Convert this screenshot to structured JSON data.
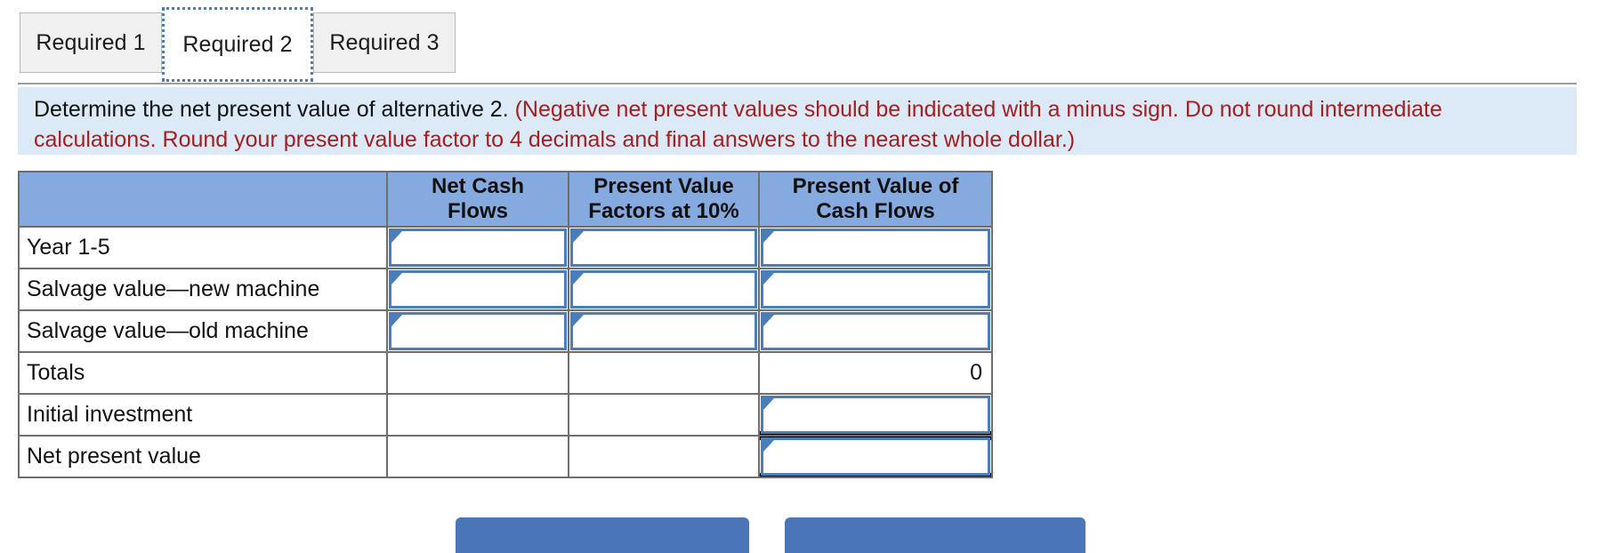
{
  "tabs": [
    {
      "label": "Required 1",
      "selected": false
    },
    {
      "label": "Required 2",
      "selected": true
    },
    {
      "label": "Required 3",
      "selected": false
    }
  ],
  "instruction": {
    "prompt": "Determine the net present value of alternative 2.",
    "note": "(Negative net present values should be indicated with a minus sign. Do not round intermediate calculations. Round your present value factor to 4 decimals and final answers to the nearest whole dollar.)"
  },
  "table": {
    "headers": [
      "",
      "Net Cash Flows",
      "Present Value Factors at 10%",
      "Present Value of Cash Flows"
    ],
    "header_lines": [
      [
        "",
        ""
      ],
      [
        "Net Cash",
        "Flows"
      ],
      [
        "Present Value",
        "Factors at 10%"
      ],
      [
        "Present Value of",
        "Cash Flows"
      ]
    ],
    "rows": [
      {
        "label": "Year 1-5",
        "net_cash_flows": {
          "value": "",
          "type": "input"
        },
        "pv_factors": {
          "value": "",
          "type": "input"
        },
        "pv_cash_flows": {
          "value": "",
          "type": "input"
        }
      },
      {
        "label": "Salvage value—new machine",
        "net_cash_flows": {
          "value": "",
          "type": "input"
        },
        "pv_factors": {
          "value": "",
          "type": "input"
        },
        "pv_cash_flows": {
          "value": "",
          "type": "input"
        }
      },
      {
        "label": "Salvage value—old machine",
        "net_cash_flows": {
          "value": "",
          "type": "input"
        },
        "pv_factors": {
          "value": "",
          "type": "input"
        },
        "pv_cash_flows": {
          "value": "",
          "type": "input"
        }
      },
      {
        "label": "Totals",
        "net_cash_flows": {
          "value": "",
          "type": "static"
        },
        "pv_factors": {
          "value": "",
          "type": "static"
        },
        "pv_cash_flows": {
          "value": "0",
          "type": "static"
        }
      },
      {
        "label": "Initial investment",
        "net_cash_flows": {
          "value": "",
          "type": "static"
        },
        "pv_factors": {
          "value": "",
          "type": "static"
        },
        "pv_cash_flows": {
          "value": "",
          "type": "input"
        }
      },
      {
        "label": "Net present value",
        "net_cash_flows": {
          "value": "",
          "type": "static"
        },
        "pv_factors": {
          "value": "",
          "type": "static"
        },
        "pv_cash_flows": {
          "value": "",
          "type": "input"
        }
      }
    ]
  },
  "buttons": {
    "prev": "",
    "next": ""
  },
  "colors": {
    "header_blue": "#85aae0",
    "input_border_blue": "#4a7ebb",
    "banner_blue": "#dce9f7",
    "note_red": "#a32020",
    "button_blue": "#4a76b8",
    "tab_inactive": "#f0f0f0"
  }
}
